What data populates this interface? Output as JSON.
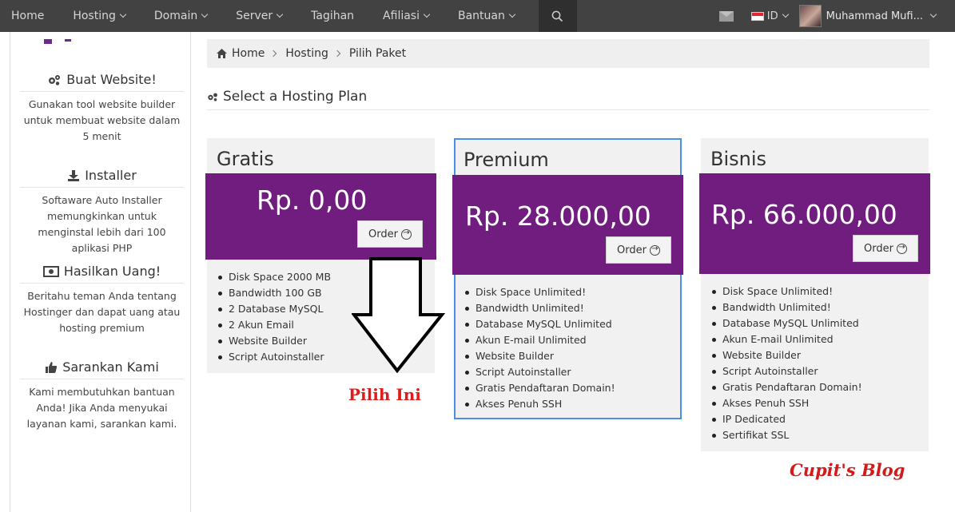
{
  "nav": {
    "items": [
      "Home",
      "Hosting",
      "Domain",
      "Server",
      "Tagihan",
      "Afiliasi",
      "Bantuan"
    ],
    "language": "ID",
    "user_name": "Muhammad Mufi...",
    "icons": [
      "search-icon",
      "mail-icon",
      "flag-icon",
      "avatar"
    ]
  },
  "sidebar": {
    "blocks": [
      {
        "icon": "gears-icon",
        "title": "Buat Website!",
        "desc": "Gunakan tool website builder untuk membuat website dalam 5 menit"
      },
      {
        "icon": "download-icon",
        "title": "Installer",
        "desc": "Softaware Auto Installer memungkinkan untuk menginstal lebih dari 100 aplikasi PHP"
      },
      {
        "icon": "money-icon",
        "title": "Hasilkan Uang!",
        "desc": "Beritahu teman Anda tentang Hostinger dan dapat uang atau hosting premium"
      },
      {
        "icon": "thumbs-up-icon",
        "title": "Sarankan Kami",
        "desc": "Kami membutuhkan bantuan Anda! Jika Anda menyukai layanan kami, sarankan kami."
      }
    ]
  },
  "breadcrumb": [
    "Home",
    "Hosting",
    "Pilih Paket"
  ],
  "section_title": "Select a Hosting Plan",
  "plans": [
    {
      "name": "Gratis",
      "price": "Rp. 0,00",
      "order_label": "Order",
      "features": [
        "Disk Space 2000 MB",
        "Bandwidth 100 GB",
        "2 Database MySQL",
        "2 Akun Email",
        "Website Builder",
        "Script Autoinstaller"
      ]
    },
    {
      "name": "Premium",
      "price": "Rp. 28.000,00",
      "order_label": "Order",
      "features": [
        "Disk Space Unlimited!",
        "Bandwidth Unlimited!",
        "Database MySQL Unlimited",
        "Akun E-mail Unlimited",
        "Website Builder",
        "Script Autoinstaller",
        "Gratis Pendaftaran Domain!",
        "Akses Penuh SSH"
      ]
    },
    {
      "name": "Bisnis",
      "price": "Rp. 66.000,00",
      "order_label": "Order",
      "features": [
        "Disk Space Unlimited!",
        "Bandwidth Unlimited!",
        "Database MySQL Unlimited",
        "Akun E-mail Unlimited",
        "Website Builder",
        "Script Autoinstaller",
        "Gratis Pendaftaran Domain!",
        "Akses Penuh SSH",
        "IP Dedicated",
        "Sertifikat SSL"
      ]
    }
  ],
  "annotations": {
    "pilih": "Pilih Ini",
    "blog": "Cupit's Blog"
  },
  "colors": {
    "brand_purple": "#711d80",
    "nav_bg": "#424242",
    "highlight_border": "#4a90e2",
    "annotation_red": "#e01b1b"
  }
}
